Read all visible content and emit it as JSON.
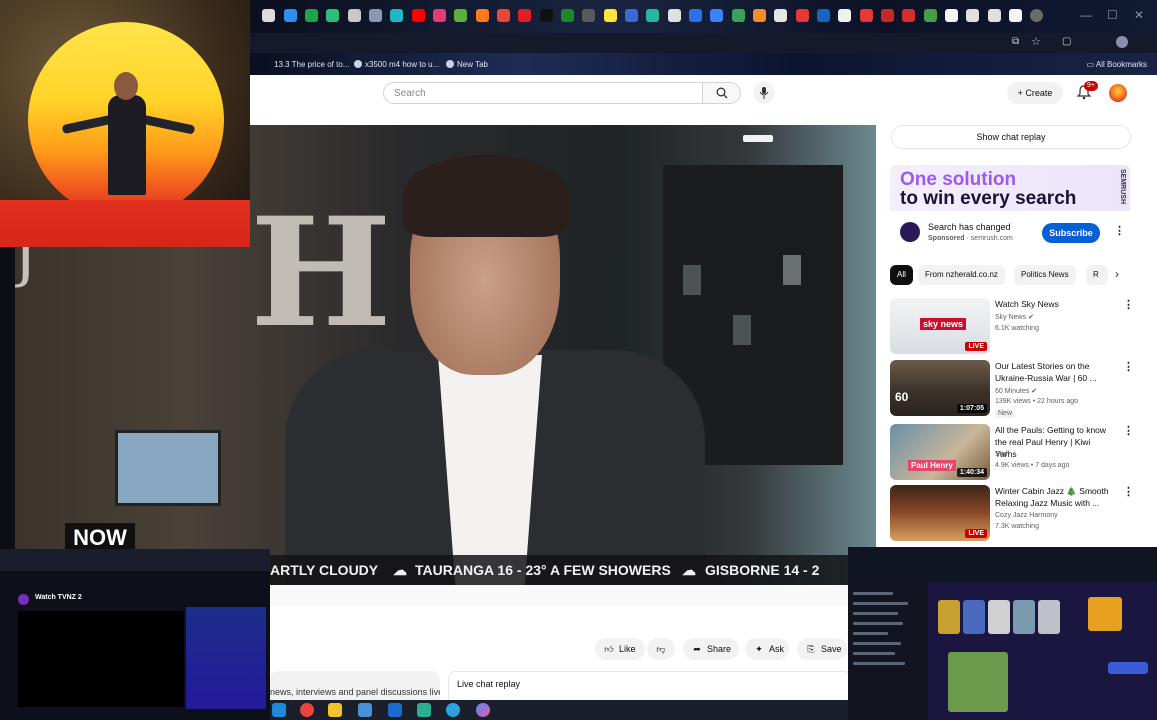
{
  "browser": {
    "bookmarks": [
      {
        "label": "13.3 The price of to..."
      },
      {
        "label": "x3500 m4 how to u..."
      },
      {
        "label": "New Tab"
      }
    ],
    "all_bookmarks_label": "All Bookmarks"
  },
  "youtube": {
    "search_placeholder": "Search",
    "create_label": "Create",
    "notification_count": "9+",
    "video": {
      "ticker": [
        "ARTLY CLOUDY",
        "TAURANGA 16 - 23° A FEW SHOWERS",
        "GISBORNE 14 - 2"
      ],
      "now_label": "NOW"
    },
    "actions": {
      "like": "Like",
      "share": "Share",
      "ask": "Ask",
      "save": "Save"
    },
    "description_snippet": "news, interviews and panel discussions live",
    "live_chat_label": "Live chat replay",
    "sidebar": {
      "show_chat_replay": "Show chat replay",
      "ad": {
        "headline_1": "One solution",
        "headline_2": "to win every search",
        "brand_vertical": "SEMRUSH",
        "title": "Search has changed",
        "sponsored": "Sponsored",
        "domain": "semrush.com",
        "cta": "Subscribe"
      },
      "chips": [
        "All",
        "From nzherald.co.nz",
        "Politics News",
        "R"
      ],
      "recommendations": [
        {
          "title": "Watch Sky News",
          "channel": "Sky News",
          "meta": "6.1K watching",
          "badge": "LIVE",
          "extra": ""
        },
        {
          "title": "Our Latest Stories on the Ukraine-Russia War | 60 ...",
          "channel": "60 Minutes",
          "meta": "139K views • 22 hours ago",
          "badge": "1:07:05",
          "extra": "New"
        },
        {
          "title": "All the Pauls: Getting to know the real Paul Henry | Kiwi Yarns",
          "channel": "Stuff",
          "meta": "4.9K views • 7 days ago",
          "badge": "1:40:34",
          "extra": ""
        },
        {
          "title": "Winter Cabin Jazz 🎄 Smooth Relaxing Jazz Music with ...",
          "channel": "Cozy Jazz Harmony",
          "meta": "7.3K watching",
          "badge": "LIVE",
          "extra": ""
        }
      ]
    }
  },
  "overlays": {
    "bottom_left_title": "Watch TVNZ 2"
  },
  "colors": {
    "youtube_red": "#cc0000",
    "subscribe_blue": "#065fd4",
    "ad_purple": "#9c5bf0"
  }
}
